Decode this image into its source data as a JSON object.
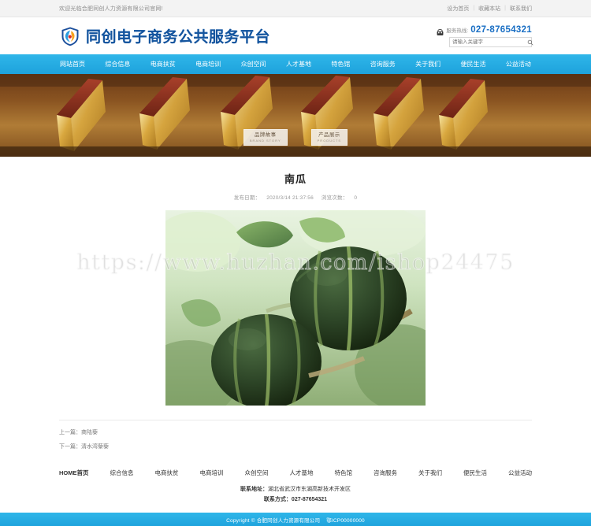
{
  "topbar": {
    "welcome": "欢迎光临合肥同创人力资源有限公司官网!",
    "links": [
      {
        "label": "设为首页"
      },
      {
        "label": "收藏本站"
      },
      {
        "label": "联系我们"
      }
    ],
    "separator": "|"
  },
  "header": {
    "brand_name": "同创电子商务公共服务平台",
    "logo_icon": "shield-flame-logo",
    "hotline_label": "服务热线:",
    "hotline_number": "027-87654321",
    "phone_icon": "telephone-icon",
    "search_placeholder": "请输入关键字",
    "search_value": "",
    "search_icon": "search-icon"
  },
  "nav": {
    "items": [
      {
        "label": "网站首页"
      },
      {
        "label": "综合信息"
      },
      {
        "label": "电商扶贫"
      },
      {
        "label": "电商培训"
      },
      {
        "label": "众创空间"
      },
      {
        "label": "人才基地"
      },
      {
        "label": "特色馆"
      },
      {
        "label": "咨询服务"
      },
      {
        "label": "关于我们"
      },
      {
        "label": "便民生活"
      },
      {
        "label": "公益活动"
      }
    ],
    "accent_color": "#25ace3"
  },
  "banner": {
    "alt": "antique-books-banner",
    "buttons": [
      {
        "label": "品牌故事",
        "sub": "BRAND STORY"
      },
      {
        "label": "产品展示",
        "sub": "PRODUCTS"
      }
    ]
  },
  "article": {
    "title": "南瓜",
    "publish_label": "发布日期：",
    "publish_date": "2020/3/14 21:37:56",
    "views_label": "浏览次数：",
    "views": "0",
    "image_alt": "green-pumpkins-on-vine",
    "watermark": "https://www.huzhan.com/ishop24475",
    "prev_label": "上一篇：",
    "prev_title": "商陆藜",
    "next_label": "下一篇：",
    "next_title": "清水湾藜藜"
  },
  "footer": {
    "nav": [
      {
        "label": "HOME首页"
      },
      {
        "label": "综合信息"
      },
      {
        "label": "电商扶贫"
      },
      {
        "label": "电商培训"
      },
      {
        "label": "众创空间"
      },
      {
        "label": "人才基地"
      },
      {
        "label": "特色馆"
      },
      {
        "label": "咨询服务"
      },
      {
        "label": "关于我们"
      },
      {
        "label": "便民生活"
      },
      {
        "label": "公益活动"
      }
    ],
    "address_label": "联系地址：",
    "address": "湖北省武汉市东湖高新技术开发区",
    "phone_label": "联系方式：",
    "phone": "027-87654321",
    "copyright": "Copyright © 合肥同创人力资源有限公司",
    "icp": "鄂ICP00000000"
  }
}
